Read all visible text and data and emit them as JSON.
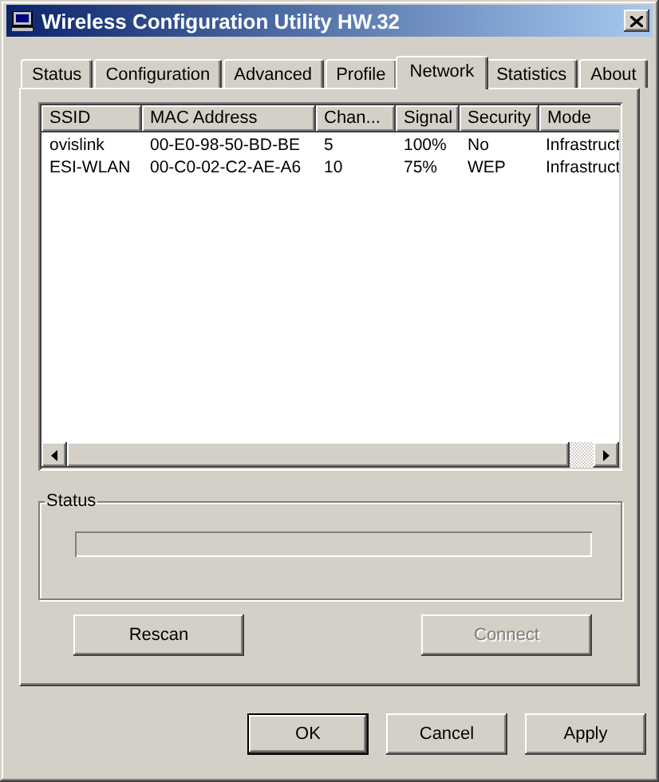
{
  "window": {
    "title": "Wireless Configuration Utility HW.32"
  },
  "tabs": [
    {
      "label": "Status",
      "selected": false
    },
    {
      "label": "Configuration",
      "selected": false
    },
    {
      "label": "Advanced",
      "selected": false
    },
    {
      "label": "Profile",
      "selected": false
    },
    {
      "label": "Network",
      "selected": true
    },
    {
      "label": "Statistics",
      "selected": false
    },
    {
      "label": "About",
      "selected": false
    }
  ],
  "network_list": {
    "columns": [
      "SSID",
      "MAC Address",
      "Chan...",
      "Signal",
      "Security",
      "Mode"
    ],
    "rows": [
      [
        "ovislink",
        "00-E0-98-50-BD-BE",
        "5",
        "100%",
        "No",
        "Infrastruct"
      ],
      [
        "ESI-WLAN",
        "00-C0-02-C2-AE-A6",
        "10",
        "75%",
        "WEP",
        "Infrastruct"
      ]
    ]
  },
  "status_group": {
    "label": "Status",
    "progress": {
      "level": 0
    }
  },
  "action_buttons": [
    {
      "label": "Rescan",
      "disabled": false
    },
    {
      "label": "Connect",
      "disabled": true
    }
  ],
  "dialog_buttons": [
    {
      "label": "OK",
      "default": true
    },
    {
      "label": "Cancel",
      "default": false
    },
    {
      "label": "Apply",
      "default": false
    }
  ]
}
